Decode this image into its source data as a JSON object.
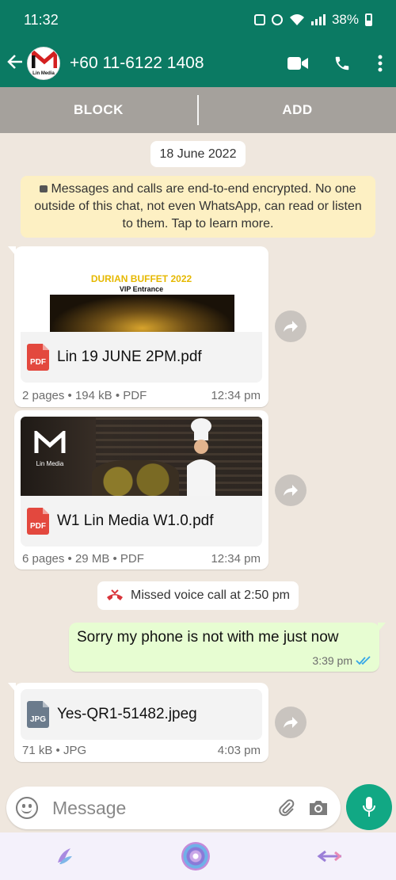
{
  "status_bar": {
    "time": "11:32",
    "battery": "38%"
  },
  "header": {
    "title": "+60 11-6122 1408",
    "avatar_text": "Lin Media",
    "icons": [
      "back-arrow-icon",
      "video-call-icon",
      "voice-call-icon",
      "more-vert-icon"
    ]
  },
  "actions": {
    "block": "BLOCK",
    "add": "ADD"
  },
  "chat": {
    "date": "18 June 2022",
    "encryption_notice": "Messages and calls are end-to-end encrypted. No one outside of this chat, not even WhatsApp, can read or listen to them. Tap to learn more.",
    "messages": [
      {
        "type": "document",
        "preview_title": "DURIAN BUFFET 2022",
        "preview_subtitle": "VIP Entrance",
        "file_name": "Lin 19 JUNE 2PM.pdf",
        "file_type": "PDF",
        "meta": "2 pages • 194 kB • PDF",
        "time": "12:34 pm"
      },
      {
        "type": "document",
        "preview_logo": "Lin Media",
        "file_name": "W1 Lin Media W1.0.pdf",
        "file_type": "PDF",
        "meta": "6 pages • 29 MB • PDF",
        "time": "12:34 pm"
      },
      {
        "type": "missed_call",
        "text": "Missed voice call at 2:50 pm"
      },
      {
        "type": "outgoing_text",
        "text": "Sorry my phone is not with me just now",
        "time": "3:39 pm"
      },
      {
        "type": "document",
        "file_name": "Yes-QR1-51482.jpeg",
        "file_type": "JPG",
        "meta": "71 kB • JPG",
        "time": "4:03 pm"
      }
    ]
  },
  "composer": {
    "placeholder": "Message"
  },
  "colors": {
    "header": "#0b7a63",
    "accent": "#11a884",
    "outgoing_bubble": "#e7fdd2",
    "notice": "#fdf0c3"
  }
}
